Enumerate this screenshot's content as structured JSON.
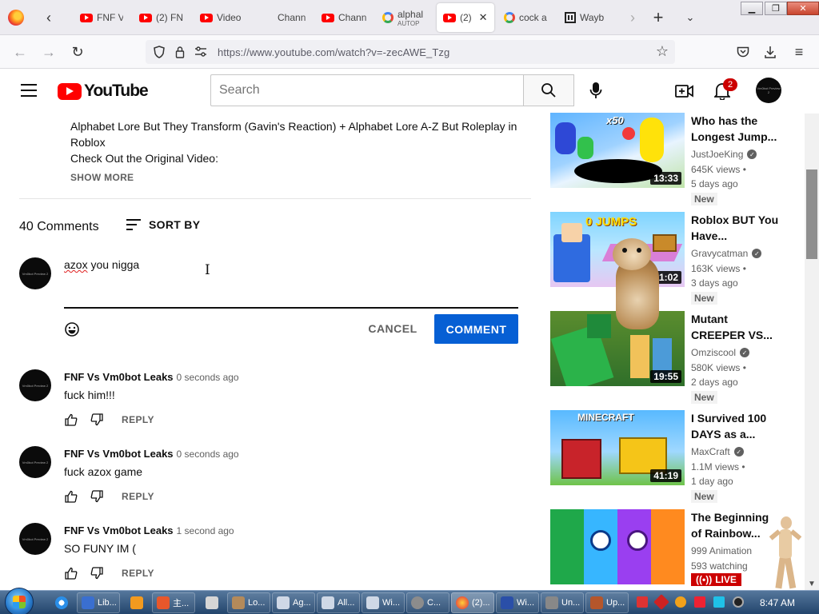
{
  "browser": {
    "tabs": [
      {
        "icon": "youtube-favicon",
        "title": "FNF V",
        "sub": ""
      },
      {
        "icon": "youtube-favicon",
        "title": "(2) FN",
        "sub": ""
      },
      {
        "icon": "youtube-favicon",
        "title": "Video",
        "sub": ""
      },
      {
        "icon": "none",
        "title": "Chann",
        "sub": ""
      },
      {
        "icon": "youtube-favicon",
        "title": "Chann",
        "sub": ""
      },
      {
        "icon": "google-favicon",
        "title": "alphal",
        "sub": "AUTOP"
      },
      {
        "icon": "youtube-favicon",
        "title": "(2)",
        "sub": "",
        "active": true
      },
      {
        "icon": "google-favicon",
        "title": "cock a",
        "sub": ""
      },
      {
        "icon": "wayback-favicon",
        "title": "Wayb",
        "sub": ""
      }
    ],
    "url": "https://www.youtube.com/watch?v=-zecAWE_Tzg"
  },
  "youtube": {
    "logo_text": "YouTube",
    "search_placeholder": "Search",
    "notification_count": "2",
    "avatar_text": "Vm0bot Preview 2"
  },
  "description": {
    "lines": [
      "Alphabet Lore But They Transform (Gavin's Reaction) + Alphabet Lore A-Z But Roleplay in Roblox",
      "Check Out the Original Video:"
    ],
    "show_more": "SHOW MORE"
  },
  "comments_section": {
    "count_label": "40 Comments",
    "sort_label": "SORT BY",
    "draft_word1": "azox",
    "draft_rest": " you nigga",
    "cancel_label": "CANCEL",
    "comment_label": "COMMENT",
    "reply_label": "REPLY",
    "items": [
      {
        "author": "FNF Vs Vm0bot Leaks",
        "time": "0 seconds ago",
        "text": "fuck him!!!"
      },
      {
        "author": "FNF Vs Vm0bot Leaks",
        "time": "0 seconds ago",
        "text": "fuck azox game"
      },
      {
        "author": "FNF Vs Vm0bot Leaks",
        "time": "1 second ago",
        "text": "SO FUNY IM ("
      }
    ]
  },
  "recommendations": [
    {
      "title": "Who has the Longest Jump...",
      "channel": "JustJoeKing",
      "views": "645K views •",
      "age": "5 days ago",
      "badge": "New",
      "duration": "13:33",
      "thumb_text": "x50"
    },
    {
      "title": "Roblox BUT You Have...",
      "channel": "Gravycatman",
      "views": "163K views •",
      "age": "3 days ago",
      "badge": "New",
      "duration": "11:02",
      "thumb_text": "0 JUMPS"
    },
    {
      "title": "Mutant CREEPER VS...",
      "channel": "Omziscool",
      "views": "580K views •",
      "age": "2 days ago",
      "badge": "New",
      "duration": "19:55",
      "thumb_text": ""
    },
    {
      "title": "I Survived 100 DAYS as a...",
      "channel": "MaxCraft",
      "views": "1.1M views •",
      "age": "1 day ago",
      "badge": "New",
      "duration": "41:19",
      "thumb_text": "MINECRAFT"
    },
    {
      "title": "The Beginning of Rainbow...",
      "channel": "999 Animation",
      "views": "593 watching",
      "age": "",
      "badge": "LIVE",
      "duration": "",
      "thumb_text": ""
    }
  ],
  "taskbar": {
    "items": [
      "Lib...",
      "主...",
      "Lo...",
      "Ag...",
      "All...",
      "Wi...",
      "C...",
      "(2)...",
      "Wi...",
      "Un...",
      "Up..."
    ],
    "clock": "8:47 AM"
  }
}
